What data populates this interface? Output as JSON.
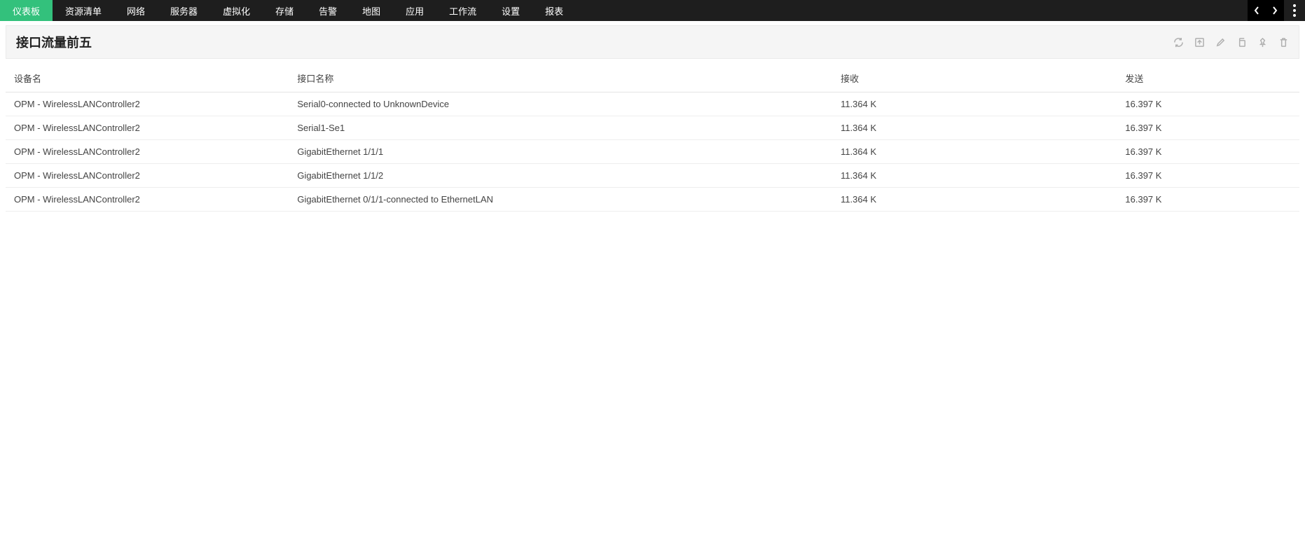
{
  "colors": {
    "accent": "#33c17c",
    "navbar": "#1e1e1e"
  },
  "nav": {
    "items": [
      {
        "label": "仪表板",
        "active": true
      },
      {
        "label": "资源清单"
      },
      {
        "label": "网络"
      },
      {
        "label": "服务器"
      },
      {
        "label": "虚拟化"
      },
      {
        "label": "存储"
      },
      {
        "label": "告警"
      },
      {
        "label": "地图"
      },
      {
        "label": "应用"
      },
      {
        "label": "工作流"
      },
      {
        "label": "设置"
      },
      {
        "label": "报表"
      }
    ]
  },
  "widget": {
    "title": "接口流量前五",
    "actions": [
      {
        "name": "refresh-icon"
      },
      {
        "name": "export-icon"
      },
      {
        "name": "edit-icon"
      },
      {
        "name": "copy-icon"
      },
      {
        "name": "pin-icon"
      },
      {
        "name": "delete-icon"
      }
    ]
  },
  "table": {
    "columns": [
      "设备名",
      "接口名称",
      "接收",
      "发送"
    ],
    "rows": [
      {
        "device": "OPM - WirelessLANController2",
        "interface": "Serial0-connected to UnknownDevice",
        "rx": "11.364 K",
        "tx": "16.397 K"
      },
      {
        "device": "OPM - WirelessLANController2",
        "interface": "Serial1-Se1",
        "rx": "11.364 K",
        "tx": "16.397 K"
      },
      {
        "device": "OPM - WirelessLANController2",
        "interface": "GigabitEthernet 1/1/1",
        "rx": "11.364 K",
        "tx": "16.397 K"
      },
      {
        "device": "OPM - WirelessLANController2",
        "interface": "GigabitEthernet 1/1/2",
        "rx": "11.364 K",
        "tx": "16.397 K"
      },
      {
        "device": "OPM - WirelessLANController2",
        "interface": "GigabitEthernet 0/1/1-connected to EthernetLAN",
        "rx": "11.364 K",
        "tx": "16.397 K"
      }
    ]
  }
}
